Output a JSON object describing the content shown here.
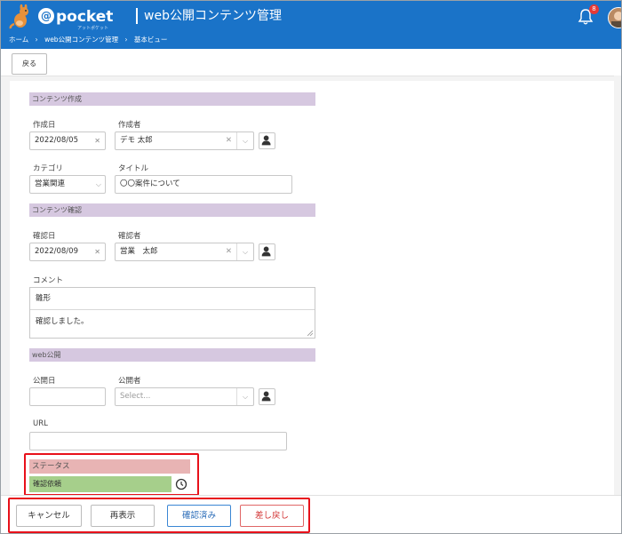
{
  "header": {
    "logo_text": "pocket",
    "logo_at": "@",
    "logo_sub": "アットポケット",
    "app_title": "web公開コンテンツ管理",
    "notification_count": "8"
  },
  "breadcrumb": [
    "ホーム",
    "›",
    "web公開コンテンツ管理",
    "›",
    "基本ビュー"
  ],
  "toolbar": {
    "back_label": "戻る"
  },
  "sections": {
    "create": {
      "title": "コンテンツ作成",
      "created_date_label": "作成日",
      "created_date_value": "2022/08/05",
      "creator_label": "作成者",
      "creator_value": "デモ 太郎",
      "category_label": "カテゴリ",
      "category_value": "営業関連",
      "title_label": "タイトル",
      "title_value": "〇〇案件について"
    },
    "confirm": {
      "title": "コンテンツ確認",
      "confirm_date_label": "確認日",
      "confirm_date_value": "2022/08/09",
      "confirmer_label": "確認者",
      "confirmer_value": "営業　太郎",
      "comment_label": "コメント",
      "comment_template": "雛形",
      "comment_value": "確認しました。"
    },
    "publish": {
      "title": "web公開",
      "publish_date_label": "公開日",
      "publisher_label": "公開者",
      "publisher_placeholder": "Select...",
      "url_label": "URL"
    },
    "status": {
      "title": "ステータス",
      "value": "確認依頼"
    }
  },
  "footer": {
    "cancel": "キャンセル",
    "redisplay": "再表示",
    "confirmed": "確認済み",
    "send_back": "差し戻し"
  },
  "colors": {
    "header_bg": "#1a73c8",
    "section_bg": "#d6c8e0",
    "status_head_bg": "#e8b4b4",
    "status_value_bg": "#a6cf8b",
    "highlight": "#e8111a"
  }
}
